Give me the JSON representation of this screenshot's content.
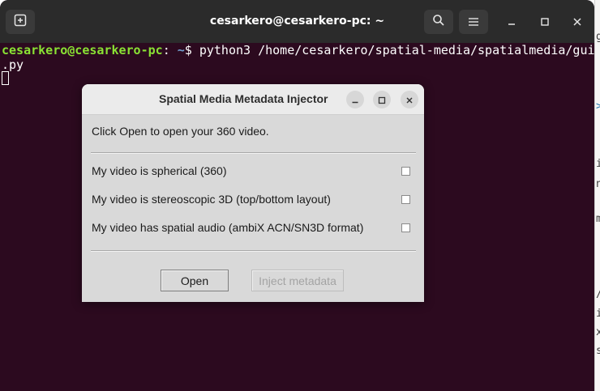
{
  "terminal": {
    "title": "cesarkero@cesarkero-pc: ~",
    "prompt_user": "cesarkero@cesarkero-pc",
    "prompt_sep": ":",
    "prompt_path": " ~",
    "prompt_symbol": "$",
    "command_line1": " python3 /home/cesarkero/spatial-media/spatialmedia/gui",
    "command_line2": ".py",
    "icons": [
      "new-tab-icon",
      "search-icon",
      "menu-icon",
      "minimize-icon",
      "maximize-icon",
      "close-icon"
    ]
  },
  "dialog": {
    "title": "Spatial Media Metadata Injector",
    "instruction": "Click Open to open your 360 video.",
    "options": [
      {
        "label": "My video is spherical (360)",
        "checked": false
      },
      {
        "label": "My video is stereoscopic 3D (top/bottom layout)",
        "checked": false
      },
      {
        "label": "My video has spatial audio (ambiX ACN/SN3D format)",
        "checked": false
      }
    ],
    "open_label": "Open",
    "inject_label": "Inject metadata",
    "inject_enabled": false
  },
  "colors": {
    "terminal_bg": "#2c0a1f",
    "titlebar_bg": "#2b2b2b",
    "prompt_user": "#8ae234",
    "prompt_path": "#729fcf",
    "dialog_bg": "#d9d9d9"
  }
}
